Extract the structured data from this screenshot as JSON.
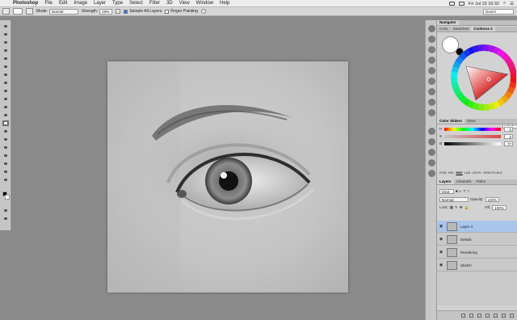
{
  "menubar": {
    "apple": "",
    "items": [
      "Photoshop",
      "File",
      "Edit",
      "Image",
      "Layer",
      "Type",
      "Select",
      "Filter",
      "3D",
      "View",
      "Window",
      "Help"
    ],
    "clock": "Fri Jul 15  16:32"
  },
  "options": {
    "mode_label": "Mode:",
    "mode_value": "Normal",
    "strength_label": "Strength:",
    "strength_value": "15%",
    "sample_all_layers": "Sample All Layers",
    "finger_painting": "Finger Painting",
    "workspace": "Daniel"
  },
  "panels": {
    "navigator_tab": "Navigator",
    "color_tabs": [
      "Color",
      "Swatches",
      "Coolorus 2"
    ],
    "hex_value": "C4C4C4",
    "slider_tabs": [
      "Color Sliders",
      "Mixer"
    ],
    "sliders": [
      {
        "label": "H",
        "value": "0"
      },
      {
        "label": "S",
        "value": "0"
      },
      {
        "label": "B",
        "value": "77"
      }
    ],
    "modes": [
      "RGB",
      "HSL",
      "HSV",
      "LAB",
      "CMYK",
      "GRAYSCALE"
    ],
    "active_mode": "HSV",
    "layer_tabs": [
      "Layers",
      "Channels",
      "Paths"
    ],
    "kind_label": "Kind",
    "blend_mode": "Normal",
    "opacity_label": "Opacity:",
    "opacity_value": "100%",
    "lock_label": "Lock:",
    "fill_label": "Fill:",
    "fill_value": "100%",
    "layers": [
      {
        "name": "Layer 4",
        "selected": true
      },
      {
        "name": "Details",
        "selected": false
      },
      {
        "name": "Rendering",
        "selected": false
      },
      {
        "name": "Sketch",
        "selected": false
      }
    ]
  },
  "colors": {
    "menubar_bg": "#ececec",
    "workspace_bg": "#8a8a8a",
    "selected_layer": "#a9c5ec"
  }
}
